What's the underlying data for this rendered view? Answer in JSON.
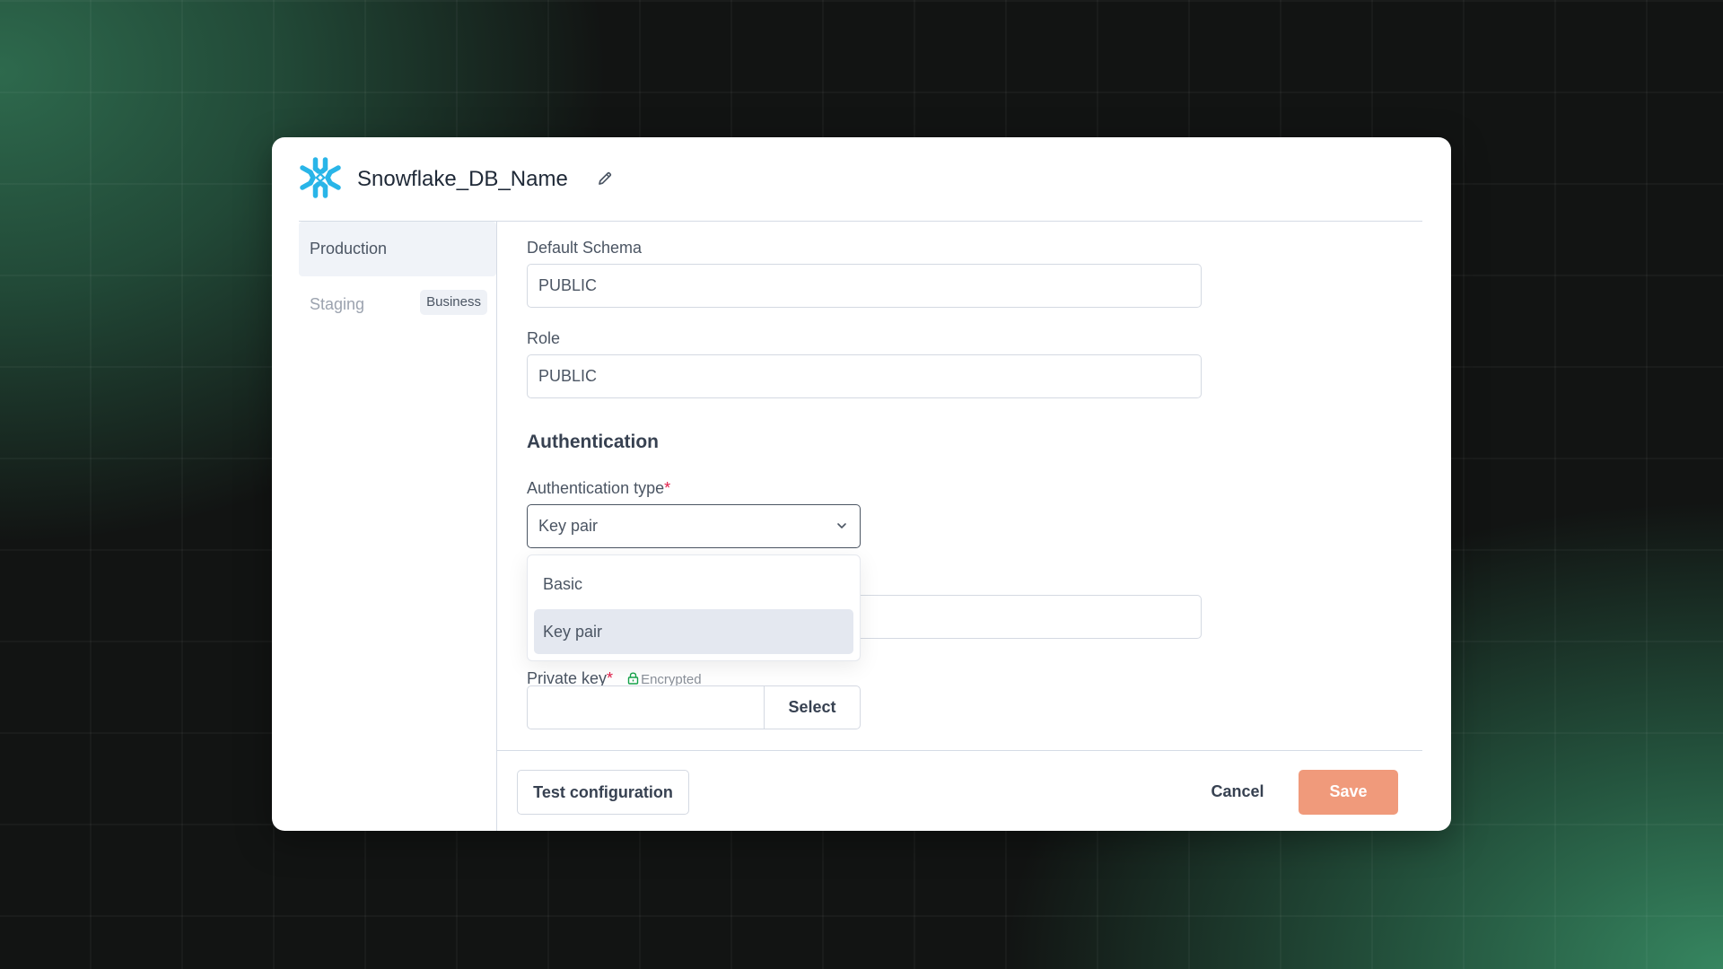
{
  "dialog": {
    "title": "Snowflake_DB_Name",
    "logo_icon": "snowflake-logo-icon",
    "edit_icon": "pencil-icon"
  },
  "sidebar": {
    "items": [
      {
        "label": "Production",
        "active": true
      },
      {
        "label": "Staging",
        "active": false,
        "badge": "Business"
      }
    ]
  },
  "form": {
    "default_schema": {
      "label": "Default Schema",
      "value": "PUBLIC"
    },
    "role": {
      "label": "Role",
      "value": "PUBLIC"
    },
    "authentication_heading": "Authentication",
    "auth_type": {
      "label": "Authentication type",
      "required_mark": "*",
      "value": "Key pair",
      "options": [
        "Basic",
        "Key pair"
      ],
      "selected_option": "Key pair"
    },
    "hidden_field": {
      "value": ""
    },
    "private_key": {
      "label": "Private key",
      "required_mark": "*",
      "encrypted_label": "Encrypted",
      "value": "",
      "select_button": "Select"
    }
  },
  "footer": {
    "test_button": "Test configuration",
    "cancel_button": "Cancel",
    "save_button": "Save"
  },
  "colors": {
    "brand_snowflake": "#29b5e8",
    "save_accent": "#f09a7b",
    "required": "#e11d48",
    "encrypted": "#16a34a"
  }
}
